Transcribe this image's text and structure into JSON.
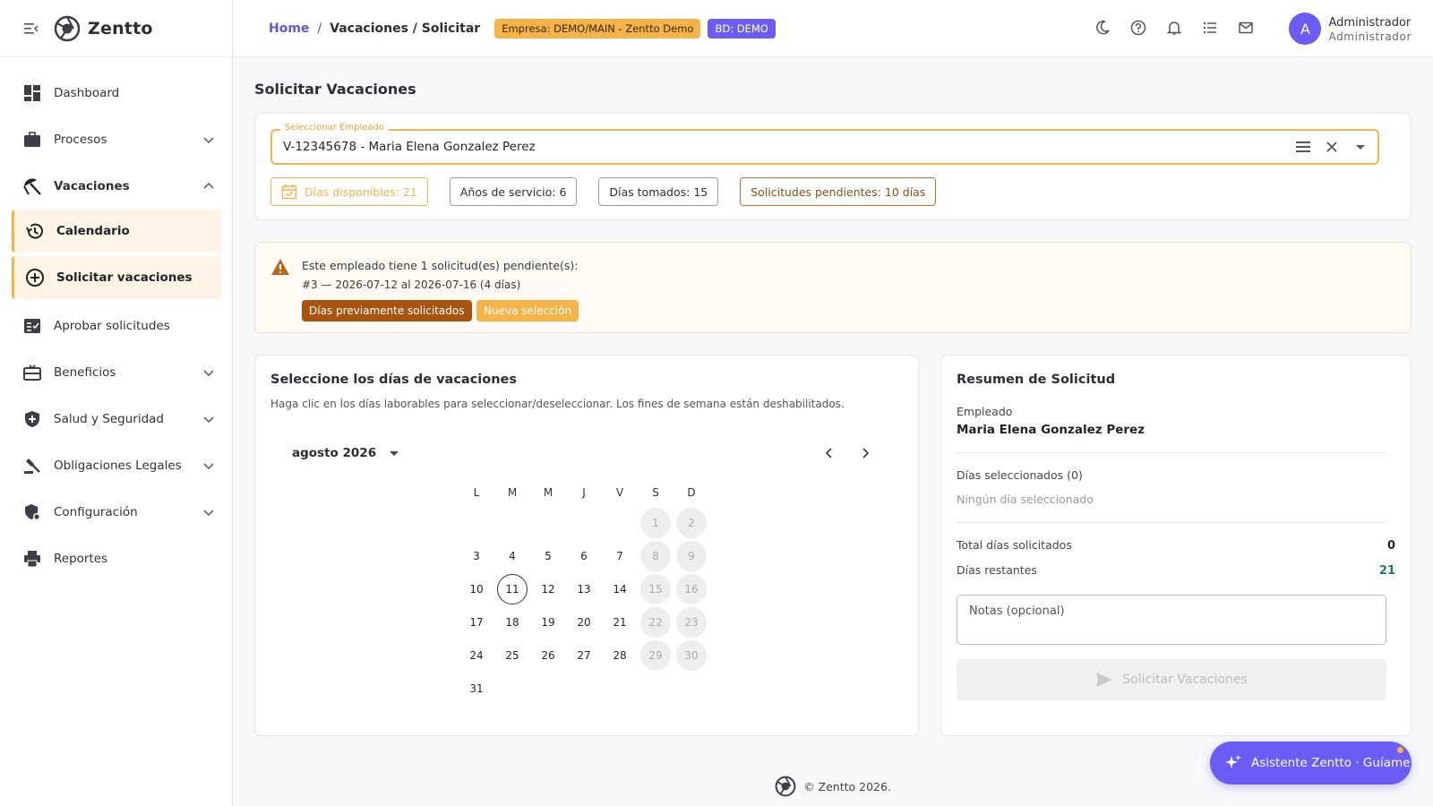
{
  "brand": {
    "name": "Zentto"
  },
  "sidebar": {
    "items": [
      {
        "label": "Dashboard"
      },
      {
        "label": "Procesos"
      },
      {
        "label": "Vacaciones"
      },
      {
        "label": "Calendario"
      },
      {
        "label": "Solicitar vacaciones"
      },
      {
        "label": "Aprobar solicitudes"
      },
      {
        "label": "Beneficios"
      },
      {
        "label": "Salud y Seguridad"
      },
      {
        "label": "Obligaciones Legales"
      },
      {
        "label": "Configuración"
      },
      {
        "label": "Reportes"
      }
    ]
  },
  "topbar": {
    "breadcrumb": {
      "home": "Home",
      "separator": "/",
      "current": "Vacaciones / Solicitar"
    },
    "empresa_chip": "Empresa: DEMO/MAIN - Zentto Demo",
    "bd_chip": "BD: DEMO",
    "user": {
      "initial": "A",
      "name": "Administrador",
      "role": "Administrador"
    }
  },
  "page": {
    "title": "Solicitar Vacaciones"
  },
  "employee": {
    "field_label": "Seleccionar Empleado",
    "value": "V-12345678 - Maria Elena Gonzalez Perez",
    "stats": {
      "available": "Días disponibles: 21",
      "years": "Años de servicio: 6",
      "taken": "Días tomados: 15",
      "pending": "Solicitudes pendientes: 10 días"
    }
  },
  "alert": {
    "line1": "Este empleado tiene 1 solicitud(es) pendiente(s):",
    "line2": "#3 — 2026-07-12 al 2026-07-16 (4 días)",
    "legend_prev": "Días previamente solicitados",
    "legend_new": "Nueva selección"
  },
  "calendar": {
    "title": "Seleccione los días de vacaciones",
    "subtitle": "Haga clic en los días laborables para seleccionar/deseleccionar. Los fines de semana están deshabilitados.",
    "month_label": "agosto 2026",
    "weekdays": [
      "L",
      "M",
      "M",
      "J",
      "V",
      "S",
      "D"
    ],
    "today": 11
  },
  "summary": {
    "title": "Resumen de Solicitud",
    "employee_label": "Empleado",
    "employee_name": "Maria Elena Gonzalez Perez",
    "selected_label": "Días seleccionados (0)",
    "none_selected": "Ningún día seleccionado",
    "total_label": "Total días solicitados",
    "total_value": "0",
    "remaining_label": "Días restantes",
    "remaining_value": "21",
    "notes_placeholder": "Notas (opcional)",
    "submit_label": "Solicitar Vacaciones"
  },
  "footer": {
    "text": "© Zentto 2026."
  },
  "assistant": {
    "label": "Asistente Zentto · Guíame"
  },
  "colors": {
    "accent": "#f5b34a",
    "brand": "#6b5cf6",
    "link": "#5b5bd6",
    "prev_requested": "#a8530f",
    "remaining": "#1e7a5a"
  }
}
